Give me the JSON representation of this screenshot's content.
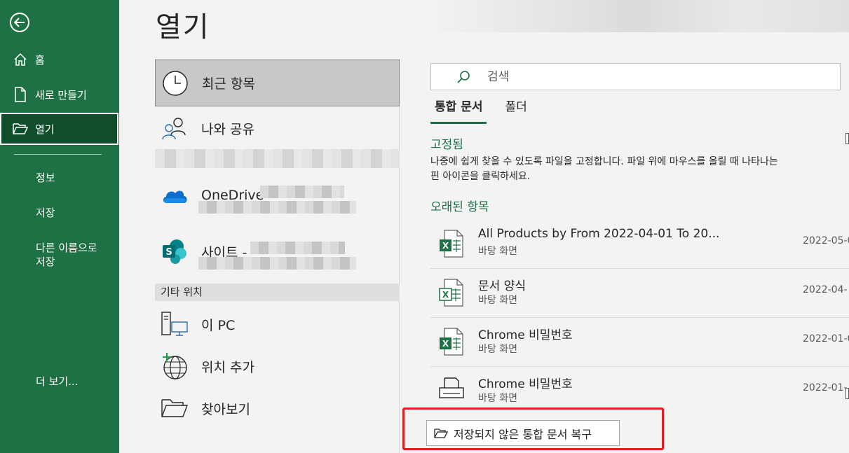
{
  "nav": {
    "home": "홈",
    "new": "새로 만들기",
    "open": "열기",
    "info": "정보",
    "save": "저장",
    "save_as_line1": "다른 이름으로",
    "save_as_line2": "저장",
    "more": "더 보기..."
  },
  "page_title": "열기",
  "locations": {
    "recent": "최근 항목",
    "shared": "나와 공유",
    "onedrive": "OneDrive -",
    "sites": "사이트 -",
    "other_header": "기타 위치",
    "this_pc": "이 PC",
    "add_place": "위치 추가",
    "browse": "찾아보기"
  },
  "search": {
    "placeholder": "검색"
  },
  "tabs": {
    "workbooks": "통합 문서",
    "folders": "폴더"
  },
  "pinned": {
    "title": "고정됨",
    "desc_line1": "나중에 쉽게 찾을 수 있도록 파일을 고정합니다. 파일 위에 마우스를 올릴 때 나타나는",
    "desc_line2": "핀 아이콘을 클릭하세요."
  },
  "older": {
    "title": "오래된 항목",
    "files": [
      {
        "name": "All Products by From 2022-04-01 To 20...",
        "path": "바탕 화면",
        "date": "2022-05-0",
        "icon": "excel-workbook-icon"
      },
      {
        "name": "문서 양식",
        "path": "바탕 화면",
        "date": "2022-04-",
        "icon": "excel-template-icon"
      },
      {
        "name": "Chrome 비밀번호",
        "path": "바탕 화면",
        "date": "2022-01-0",
        "icon": "excel-workbook-icon"
      },
      {
        "name": "Chrome 비밀번호",
        "path": "바탕 화면",
        "date": "2022-01-",
        "icon": "printer-icon"
      }
    ]
  },
  "recover_button": "저장되지 않은 통합 문서 복구",
  "colors": {
    "accent": "#1e7145",
    "accent_dark": "#0f4d2b",
    "highlight": "#e02020"
  }
}
